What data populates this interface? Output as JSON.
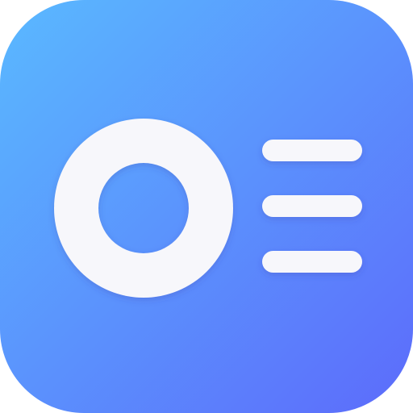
{
  "icon": {
    "name": "ring-and-lines-app-icon",
    "colors": {
      "gradient_start": "#5AB9FF",
      "gradient_end": "#5C6BFB",
      "glyph": "#F7F7FB",
      "shadow": "#3A3FA8"
    },
    "glyphs": [
      "ring-icon",
      "list-lines-icon"
    ]
  }
}
